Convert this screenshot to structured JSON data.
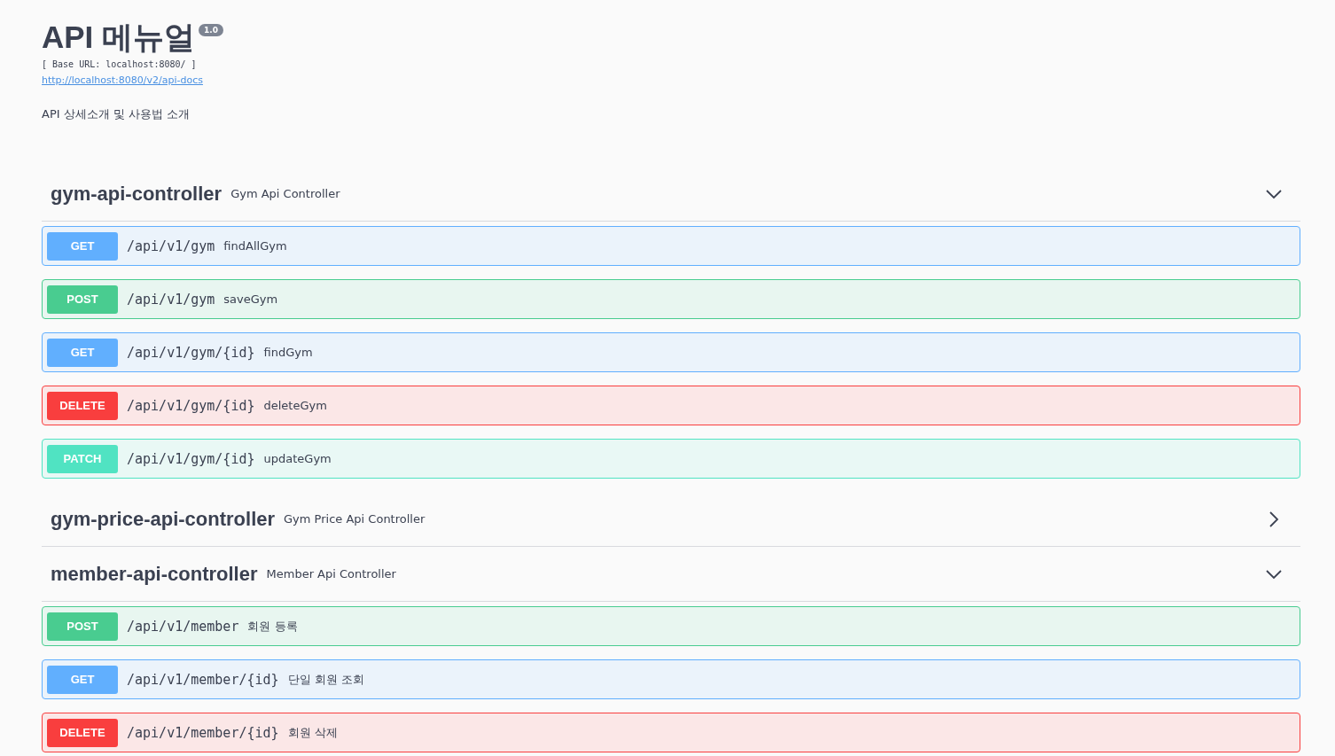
{
  "info": {
    "title": "API 메뉴얼",
    "version": "1.0",
    "base_url": "[ Base URL: localhost:8080/ ]",
    "docs_link": "http://localhost:8080/v2/api-docs",
    "description": "API 상세소개 및 사용법 소개"
  },
  "controllers": [
    {
      "name": "gym-api-controller",
      "description": "Gym Api Controller",
      "expanded": true,
      "operations": [
        {
          "kind": "get",
          "method": "GET",
          "path": "/api/v1/gym",
          "summary": "findAllGym"
        },
        {
          "kind": "post",
          "method": "POST",
          "path": "/api/v1/gym",
          "summary": "saveGym"
        },
        {
          "kind": "get",
          "method": "GET",
          "path": "/api/v1/gym/{id}",
          "summary": "findGym"
        },
        {
          "kind": "delete",
          "method": "DELETE",
          "path": "/api/v1/gym/{id}",
          "summary": "deleteGym"
        },
        {
          "kind": "patch",
          "method": "PATCH",
          "path": "/api/v1/gym/{id}",
          "summary": "updateGym"
        }
      ]
    },
    {
      "name": "gym-price-api-controller",
      "description": "Gym Price Api Controller",
      "expanded": false
    },
    {
      "name": "member-api-controller",
      "description": "Member Api Controller",
      "expanded": true,
      "operations": [
        {
          "kind": "post",
          "method": "POST",
          "path": "/api/v1/member",
          "summary": "회원 등록"
        },
        {
          "kind": "get",
          "method": "GET",
          "path": "/api/v1/member/{id}",
          "summary": "단일 회원 조회"
        },
        {
          "kind": "delete",
          "method": "DELETE",
          "path": "/api/v1/member/{id}",
          "summary": "회원 삭제"
        }
      ]
    }
  ]
}
